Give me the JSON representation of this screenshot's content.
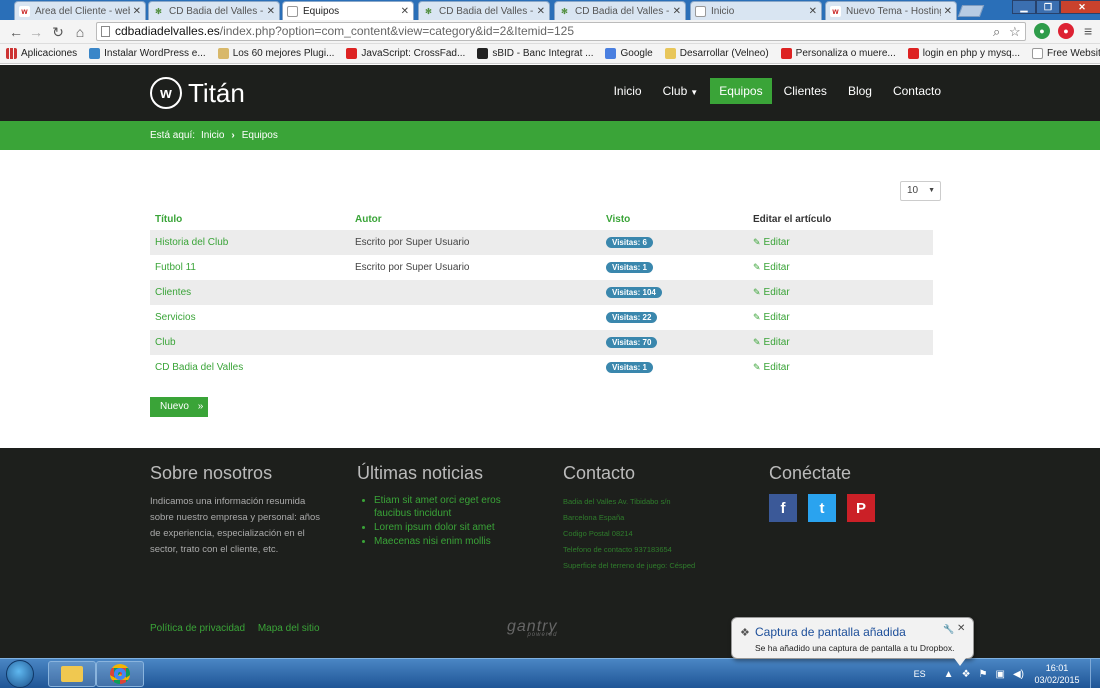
{
  "browser": {
    "tabs": [
      {
        "title": "Área del Cliente - webe",
        "favicon": "w-icon"
      },
      {
        "title": "CD Badia del Valles - Ad",
        "favicon": "joomla-icon"
      },
      {
        "title": "Equipos",
        "favicon": "doc-icon",
        "active": true
      },
      {
        "title": "CD Badia del Valles - Ad",
        "favicon": "joomla-icon"
      },
      {
        "title": "CD Badia del Valles - Ad",
        "favicon": "joomla-icon"
      },
      {
        "title": "Inicio",
        "favicon": "doc-icon"
      },
      {
        "title": "Nuevo Tema - Hosting",
        "favicon": "w-icon"
      }
    ],
    "url_host": "cdbadiadelvalles.es",
    "url_path": "/index.php?option=com_content&view=category&id=2&Itemid=125",
    "bookmarks": [
      {
        "label": "Aplicaciones",
        "icon": "apps-icon"
      },
      {
        "label": "Instalar WordPress e...",
        "icon": "wp-icon"
      },
      {
        "label": "Los 60 mejores Plugi...",
        "icon": "plugin-icon"
      },
      {
        "label": "JavaScript: CrossFad...",
        "icon": "youtube-icon"
      },
      {
        "label": "sBID - Banc Integrat ...",
        "icon": "sbid-icon"
      },
      {
        "label": "Google",
        "icon": "google-icon"
      },
      {
        "label": "Desarrollar (Velneo)",
        "icon": "folder-icon"
      },
      {
        "label": "Personaliza o muere...",
        "icon": "youtube-icon"
      },
      {
        "label": "login en php y mysq...",
        "icon": "youtube-icon"
      },
      {
        "label": "Free Website Templ...",
        "icon": "doc-icon"
      }
    ]
  },
  "site": {
    "logo_mark": "w",
    "logo_text": "Titán",
    "nav": [
      {
        "label": "Inicio"
      },
      {
        "label": "Club",
        "has_dropdown": true
      },
      {
        "label": "Equipos",
        "active": true
      },
      {
        "label": "Clientes"
      },
      {
        "label": "Blog"
      },
      {
        "label": "Contacto"
      }
    ],
    "breadcrumb": {
      "prefix": "Está aquí:",
      "items": [
        "Inicio",
        "Equipos"
      ]
    },
    "accent_color": "#3aa438"
  },
  "content": {
    "limit": "10",
    "columns": {
      "title": "Título",
      "author": "Autor",
      "hits": "Visto",
      "edit": "Editar el artículo"
    },
    "rows": [
      {
        "title": "Historia del Club",
        "author": "Escrito por Super Usuario",
        "hits": "Visitas: 6",
        "edit": "Editar"
      },
      {
        "title": "Futbol 11",
        "author": "Escrito por Super Usuario",
        "hits": "Visitas: 1",
        "edit": "Editar"
      },
      {
        "title": "Clientes",
        "author": "",
        "hits": "Visitas: 104",
        "edit": "Editar"
      },
      {
        "title": "Servicios",
        "author": "",
        "hits": "Visitas: 22",
        "edit": "Editar"
      },
      {
        "title": "Club",
        "author": "",
        "hits": "Visitas: 70",
        "edit": "Editar"
      },
      {
        "title": "CD Badia del Valles",
        "author": "",
        "hits": "Visitas: 1",
        "edit": "Editar"
      }
    ],
    "new_button": "Nuevo"
  },
  "footer": {
    "about_title": "Sobre nosotros",
    "about_text": "Indicamos una información resumida sobre nuestro empresa y personal: años de experiencia, especialización en el sector, trato con el cliente, etc.",
    "news_title": "Últimas noticias",
    "news": [
      "Etiam sit amet orci eget eros faucibus tincidunt",
      "Lorem ipsum dolor sit amet",
      "Maecenas nisi enim mollis"
    ],
    "contact_title": "Contacto",
    "contact_lines": [
      "Badia del Valles Av. Tibidabo s/n",
      "Barcelona España",
      "Codigo Postal 08214",
      "Telefono de contacto 937183654",
      "Superficie del terreno de juego: Césped"
    ],
    "social_title": "Conéctate",
    "social": [
      "facebook-icon",
      "twitter-icon",
      "pinterest-icon"
    ],
    "links": [
      "Política de privacidad",
      "Mapa del sitio"
    ],
    "powered": "gantry",
    "powered_sub": "powered"
  },
  "notification": {
    "title": "Captura de pantalla añadida",
    "body": "Se ha añadido una captura de pantalla a tu Dropbox."
  },
  "taskbar": {
    "lang": "ES",
    "time": "16:01",
    "date": "03/02/2015"
  }
}
